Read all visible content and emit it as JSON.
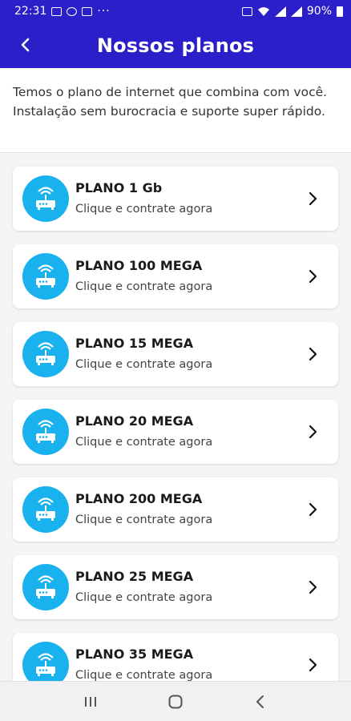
{
  "status_bar": {
    "time": "22:31",
    "dots": "···",
    "battery": "90%"
  },
  "app_bar": {
    "title": "Nossos planos",
    "back_icon": "chevron-left-icon"
  },
  "intro": {
    "text": "Temos o plano de internet que combina com você. Instalação sem burocracia e suporte super rápido."
  },
  "plans": [
    {
      "name": "PLANO 1 Gb",
      "subtitle": "Clique e contrate agora"
    },
    {
      "name": "PLANO 100 MEGA",
      "subtitle": "Clique e contrate agora"
    },
    {
      "name": "PLANO 15 MEGA",
      "subtitle": "Clique e contrate agora"
    },
    {
      "name": "PLANO 20 MEGA",
      "subtitle": "Clique e contrate agora"
    },
    {
      "name": "PLANO 200 MEGA",
      "subtitle": "Clique e contrate agora"
    },
    {
      "name": "PLANO 25 MEGA",
      "subtitle": "Clique e contrate agora"
    },
    {
      "name": "PLANO 35 MEGA",
      "subtitle": "Clique e contrate agora"
    }
  ],
  "colors": {
    "primary": "#2a1fc9",
    "icon_bg": "#19b2ef",
    "background": "#f5f5f7"
  },
  "nav_bar": {
    "recents_icon": "recents-icon",
    "home_icon": "home-icon",
    "back_icon": "back-icon"
  }
}
